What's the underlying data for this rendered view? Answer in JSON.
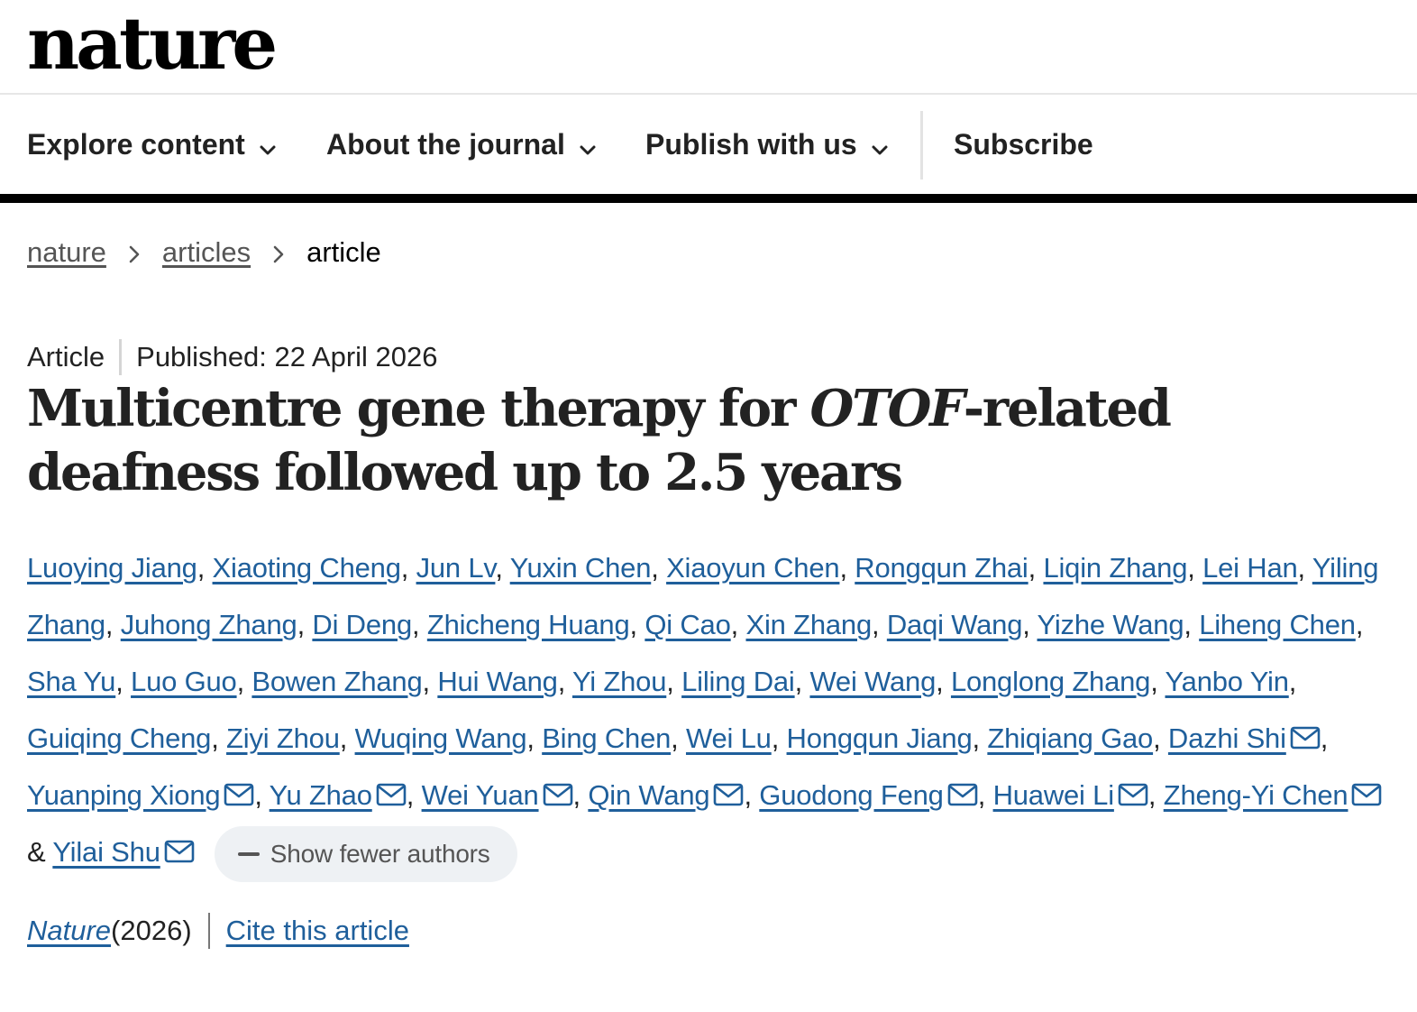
{
  "site": {
    "logo": "nature"
  },
  "nav": {
    "explore": "Explore content",
    "about": "About the journal",
    "publish": "Publish with us",
    "subscribe": "Subscribe"
  },
  "breadcrumb": [
    "nature",
    "articles",
    "article"
  ],
  "meta": {
    "type": "Article",
    "published": "Published: 22 April 2026"
  },
  "title": {
    "before": "Multicentre gene therapy for ",
    "italic": "OTOF",
    "after": "-related deafness followed up to 2.5 years"
  },
  "authors": [
    {
      "name": "Luoying Jiang",
      "mail": false
    },
    {
      "name": "Xiaoting Cheng",
      "mail": false
    },
    {
      "name": "Jun Lv",
      "mail": false
    },
    {
      "name": "Yuxin Chen",
      "mail": false
    },
    {
      "name": "Xiaoyun Chen",
      "mail": false
    },
    {
      "name": "Rongqun Zhai",
      "mail": false
    },
    {
      "name": "Liqin Zhang",
      "mail": false
    },
    {
      "name": "Lei Han",
      "mail": false
    },
    {
      "name": "Yiling Zhang",
      "mail": false
    },
    {
      "name": "Juhong Zhang",
      "mail": false
    },
    {
      "name": "Di Deng",
      "mail": false
    },
    {
      "name": "Zhicheng Huang",
      "mail": false
    },
    {
      "name": "Qi Cao",
      "mail": false
    },
    {
      "name": "Xin Zhang",
      "mail": false
    },
    {
      "name": "Daqi Wang",
      "mail": false
    },
    {
      "name": "Yizhe Wang",
      "mail": false
    },
    {
      "name": "Liheng Chen",
      "mail": false
    },
    {
      "name": "Sha Yu",
      "mail": false
    },
    {
      "name": "Luo Guo",
      "mail": false
    },
    {
      "name": "Bowen Zhang",
      "mail": false
    },
    {
      "name": "Hui Wang",
      "mail": false
    },
    {
      "name": "Yi Zhou",
      "mail": false
    },
    {
      "name": "Liling Dai",
      "mail": false
    },
    {
      "name": "Wei Wang",
      "mail": false
    },
    {
      "name": "Longlong Zhang",
      "mail": false
    },
    {
      "name": "Yanbo Yin",
      "mail": false
    },
    {
      "name": "Guiqing Cheng",
      "mail": false
    },
    {
      "name": "Ziyi Zhou",
      "mail": false
    },
    {
      "name": "Wuqing Wang",
      "mail": false
    },
    {
      "name": "Bing Chen",
      "mail": false
    },
    {
      "name": "Wei Lu",
      "mail": false
    },
    {
      "name": "Hongqun Jiang",
      "mail": false
    },
    {
      "name": "Zhiqiang Gao",
      "mail": false
    },
    {
      "name": "Dazhi Shi",
      "mail": true
    },
    {
      "name": "Yuanping Xiong",
      "mail": true
    },
    {
      "name": "Yu Zhao",
      "mail": true
    },
    {
      "name": "Wei Yuan",
      "mail": true
    },
    {
      "name": "Qin Wang",
      "mail": true
    },
    {
      "name": "Guodong Feng",
      "mail": true
    },
    {
      "name": "Huawei Li",
      "mail": true
    },
    {
      "name": "Zheng-Yi Chen",
      "mail": true
    },
    {
      "name": "Yilai Shu",
      "mail": true
    }
  ],
  "author_separator": ", ",
  "author_last_separator": " & ",
  "show_fewer": "Show fewer authors",
  "citation": {
    "journal": "Nature",
    "year": " (2026)",
    "cite": "Cite this article"
  },
  "colors": {
    "link": "#1f5f9b",
    "text": "#222222",
    "pill": "#eef1f4"
  }
}
